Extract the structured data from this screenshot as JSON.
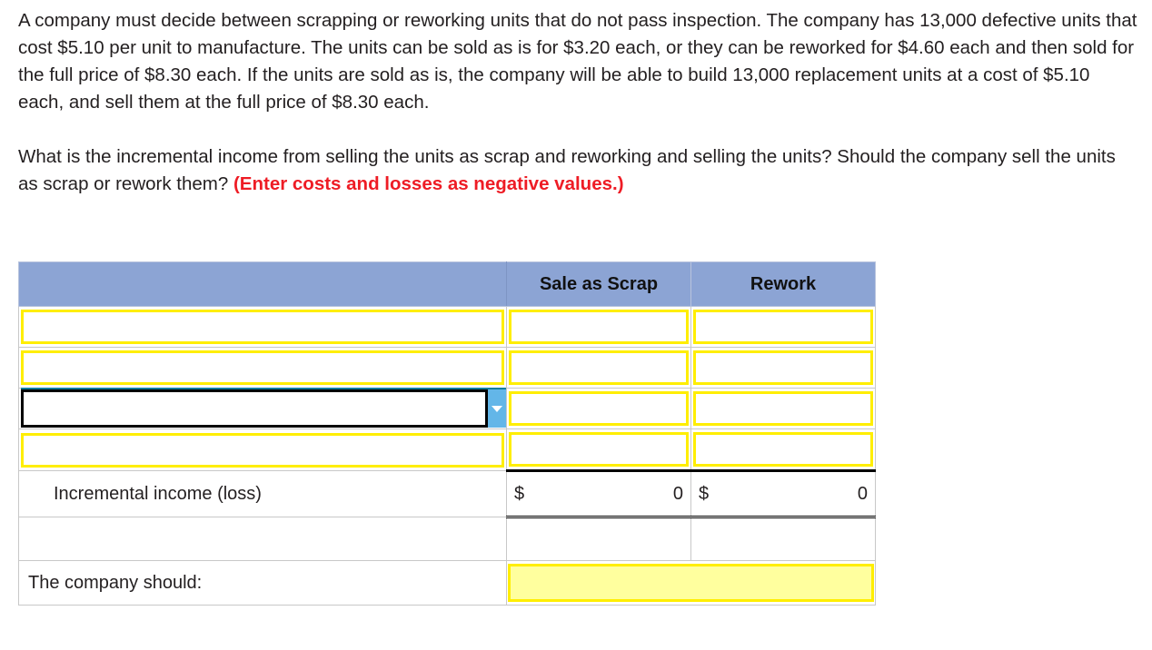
{
  "problem": {
    "paragraph1": "A company must decide between scrapping or reworking units that do not pass inspection. The company has 13,000 defective units that cost $5.10 per unit to manufacture. The units can be sold as is for $3.20 each, or they can be reworked for $4.60 each and then sold for the full price of $8.30 each. If the units are sold as is, the company will be able to build 13,000 replacement units at a cost of $5.10 each, and sell them at the full price of $8.30 each.",
    "paragraph2_plain": "What is the incremental income from selling the units as scrap and reworking and selling the units? Should the company sell the units as scrap or rework them? ",
    "paragraph2_emphasis": "(Enter costs and losses as negative values.)",
    "emphasis_color": "#ee1c25"
  },
  "worksheet": {
    "header": {
      "blank": "",
      "col_scrap": "Sale as Scrap",
      "col_rework": "Rework",
      "background_color": "#8ca4d4"
    },
    "entry_rows": [
      {
        "label": "",
        "scrap": "",
        "rework": "",
        "selected": false
      },
      {
        "label": "",
        "scrap": "",
        "rework": "",
        "selected": false
      },
      {
        "label": "",
        "scrap": "",
        "rework": "",
        "selected": true
      },
      {
        "label": "",
        "scrap": "",
        "rework": "",
        "selected": false
      }
    ],
    "total_row": {
      "label": "Incremental income (loss)",
      "scrap_currency": "$",
      "scrap_value": "0",
      "rework_currency": "$",
      "rework_value": "0"
    },
    "answer_row": {
      "label": "The company should:",
      "value": "",
      "field_background": "#ffff9e"
    },
    "input_border_color": "#ffee00",
    "dropdown_button_color": "#63b6e8"
  }
}
